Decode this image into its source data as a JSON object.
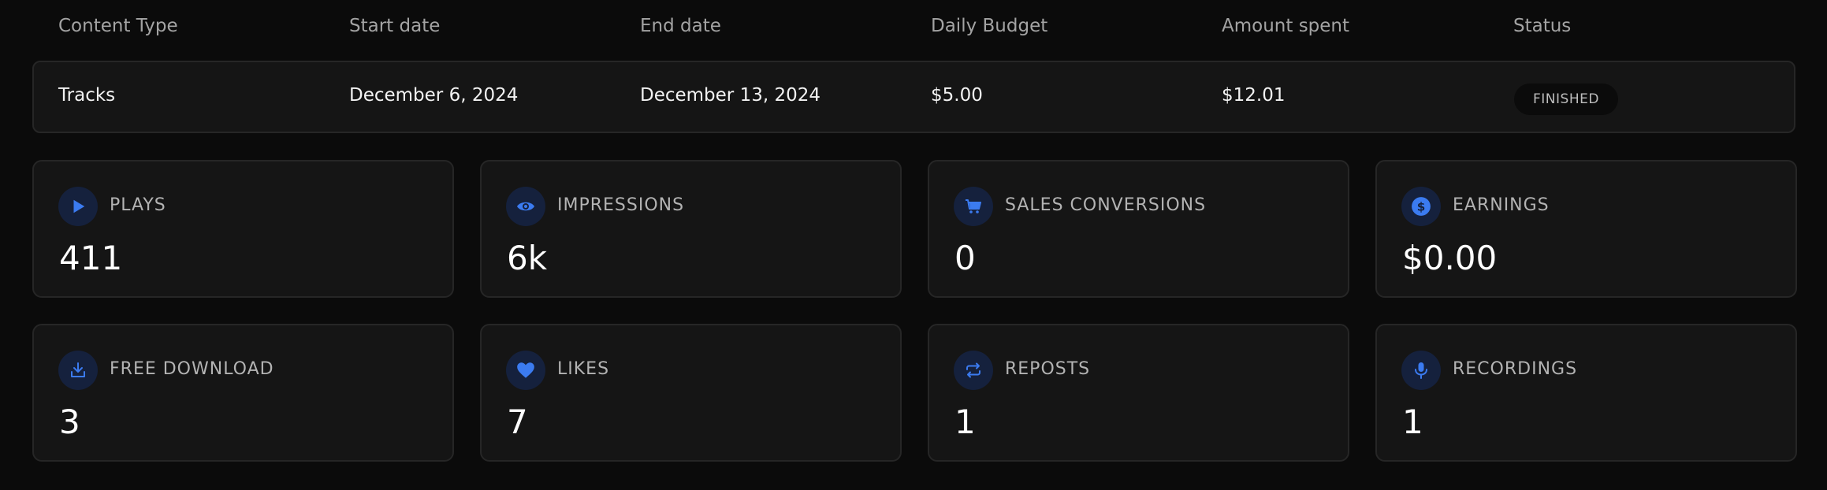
{
  "table": {
    "headers": {
      "content_type": "Content Type",
      "start_date": "Start date",
      "end_date": "End date",
      "daily_budget": "Daily Budget",
      "amount_spent": "Amount spent",
      "status": "Status"
    },
    "row": {
      "content_type": "Tracks",
      "start_date": "December 6, 2024",
      "end_date": "December 13, 2024",
      "daily_budget": "$5.00",
      "amount_spent": "$12.01",
      "status": "FINISHED"
    }
  },
  "stats": [
    {
      "label": "PLAYS",
      "value": "411",
      "icon": "play-icon"
    },
    {
      "label": "IMPRESSIONS",
      "value": "6k",
      "icon": "eye-icon"
    },
    {
      "label": "SALES CONVERSIONS",
      "value": "0",
      "icon": "cart-icon"
    },
    {
      "label": "EARNINGS",
      "value": "$0.00",
      "icon": "dollar-icon"
    },
    {
      "label": "FREE DOWNLOAD",
      "value": "3",
      "icon": "download-icon"
    },
    {
      "label": "LIKES",
      "value": "7",
      "icon": "heart-icon"
    },
    {
      "label": "REPOSTS",
      "value": "1",
      "icon": "repost-icon"
    },
    {
      "label": "RECORDINGS",
      "value": "1",
      "icon": "microphone-icon"
    }
  ],
  "colors": {
    "background": "#0b0b0b",
    "card": "#151515",
    "card_border": "#262626",
    "accent": "#3b7bf0",
    "icon_bg": "#15213d",
    "muted_text": "#a3a3a3"
  }
}
